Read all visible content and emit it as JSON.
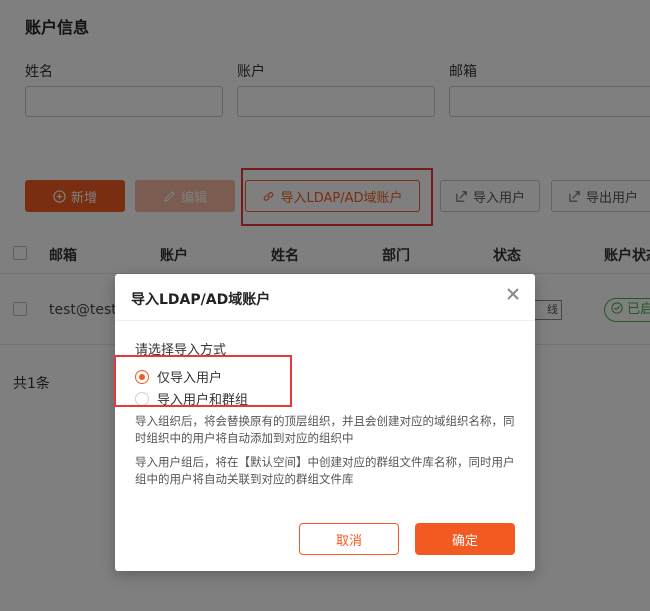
{
  "page": {
    "title": "账户信息",
    "filters": [
      {
        "label": "姓名",
        "value": ""
      },
      {
        "label": "账户",
        "value": ""
      },
      {
        "label": "邮箱",
        "value": ""
      }
    ],
    "toolbar": {
      "add": "新增",
      "edit": "编辑",
      "import_ldap": "导入LDAP/AD域账户",
      "import_users": "导入用户",
      "export_users": "导出用户"
    },
    "table": {
      "headers": [
        "邮箱",
        "账户",
        "姓名",
        "部门",
        "状态",
        "账户状态"
      ],
      "rows": [
        {
          "email": "test@test.c",
          "status": "线",
          "account_status": "已启"
        }
      ]
    },
    "total": "共1条"
  },
  "modal": {
    "title": "导入LDAP/AD域账户",
    "prompt": "请选择导入方式",
    "options": [
      {
        "label": "仅导入用户",
        "checked": true
      },
      {
        "label": "导入用户和群组",
        "checked": false
      }
    ],
    "desc1": "导入组织后，将会替换原有的顶层组织，并且会创建对应的域组织名称，同时组织中的用户将自动添加到对应的组织中",
    "desc2": "导入用户组后，将在【默认空间】中创建对应的群组文件库名称，同时用户组中的用户将自动关联到对应的群组文件库",
    "cancel": "取消",
    "confirm": "确定"
  },
  "colors": {
    "accent": "#f25a22",
    "highlight": "#e8363b",
    "success": "#43b047"
  }
}
